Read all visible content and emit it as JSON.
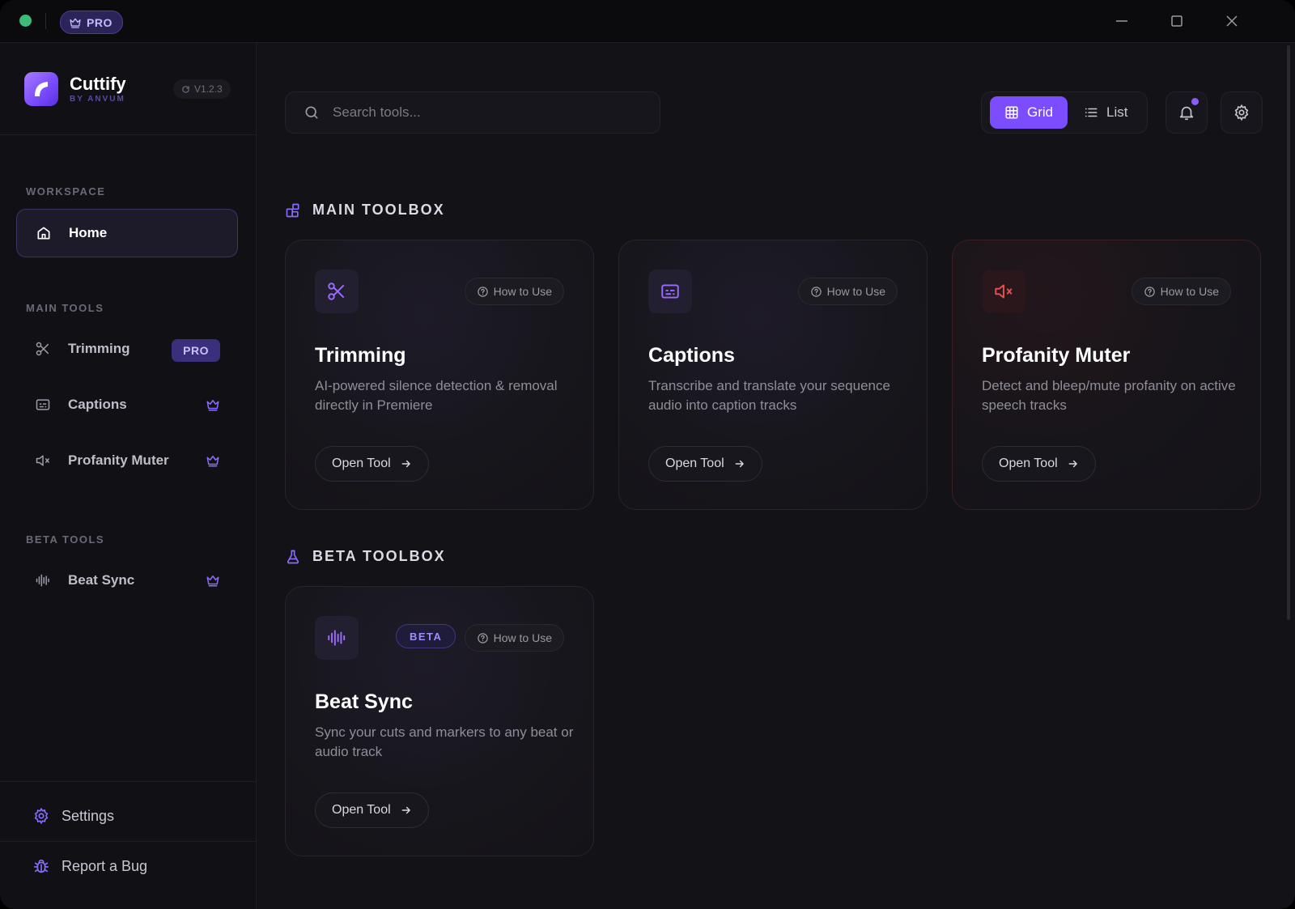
{
  "titlebar": {
    "plan_badge": "PRO"
  },
  "brand": {
    "name": "Cuttify",
    "subtitle": "BY ANVUM",
    "version": "V1.2.3"
  },
  "sidebar": {
    "workspace_label": "WORKSPACE",
    "home_label": "Home",
    "main_tools_label": "MAIN TOOLS",
    "main_tools": [
      {
        "label": "Trimming",
        "badge": "PRO"
      },
      {
        "label": "Captions"
      },
      {
        "label": "Profanity Muter"
      }
    ],
    "beta_tools_label": "BETA TOOLS",
    "beta_tools": [
      {
        "label": "Beat Sync"
      }
    ],
    "settings_label": "Settings",
    "report_label": "Report a Bug"
  },
  "search": {
    "placeholder": "Search tools..."
  },
  "view_toggle": {
    "grid_label": "Grid",
    "list_label": "List",
    "selected": "Grid"
  },
  "main_toolbox": {
    "title": "MAIN TOOLBOX",
    "cards": [
      {
        "title": "Trimming",
        "description": "AI-powered silence detection & removal directly in Premiere",
        "how_to": "How to Use",
        "open": "Open Tool"
      },
      {
        "title": "Captions",
        "description": "Transcribe and translate your sequence audio into caption tracks",
        "how_to": "How to Use",
        "open": "Open Tool"
      },
      {
        "title": "Profanity Muter",
        "description": "Detect and bleep/mute profanity on active speech tracks",
        "how_to": "How to Use",
        "open": "Open Tool"
      }
    ]
  },
  "beta_toolbox": {
    "title": "BETA TOOLBOX",
    "cards": [
      {
        "title": "Beat Sync",
        "badge": "BETA",
        "description": "Sync your cuts and markers to any beat or audio track",
        "how_to": "How to Use",
        "open": "Open Tool"
      }
    ]
  },
  "colors": {
    "accent": "#7b4dff",
    "danger": "#e0524f",
    "status_online": "#3dbb7a"
  }
}
